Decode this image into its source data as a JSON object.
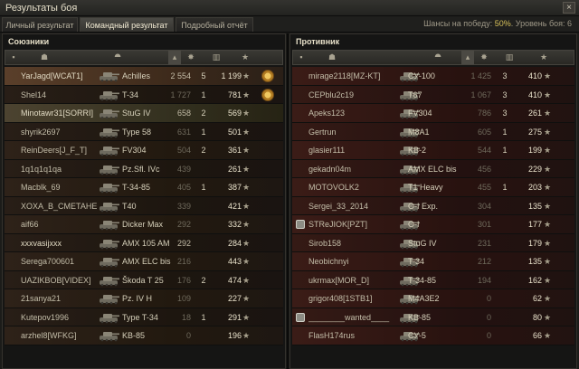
{
  "window": {
    "title": "Результаты боя",
    "close_glyph": "×"
  },
  "tabs": [
    {
      "label": "Личный результат",
      "active": false
    },
    {
      "label": "Командный результат",
      "active": true
    },
    {
      "label": "Подробный отчёт",
      "active": false
    }
  ],
  "chances": {
    "prefix": "Шансы на победу:",
    "value": "50%",
    "level": "Уровень боя: 6"
  },
  "allies": {
    "title": "Союзники",
    "header": {
      "squad": "▪",
      "player": "☗",
      "tank": "⯊",
      "sort": "▴",
      "damage": "✸",
      "kills": "▥",
      "xp": "★"
    },
    "players": [
      {
        "name": "YarJagd[WCAT1]",
        "tank": "Achilles",
        "damage": "2 554",
        "kills": "5",
        "xp": "1 199",
        "medal": true,
        "highlight": true,
        "dim": false
      },
      {
        "name": "Shel14",
        "tank": "T-34",
        "damage": "1 727",
        "kills": "1",
        "xp": "781",
        "medal": true,
        "dim": true
      },
      {
        "name": "Minotawr31[SORRI]",
        "tank": "StuG IV",
        "damage": "658",
        "kills": "2",
        "xp": "569",
        "medal": false,
        "dim": false,
        "self": true
      },
      {
        "name": "shyrik2697",
        "tank": "Type 58",
        "damage": "631",
        "kills": "1",
        "xp": "501",
        "dim": true
      },
      {
        "name": "ReinDeers[J_F_T]",
        "tank": "FV304",
        "damage": "504",
        "kills": "2",
        "xp": "361",
        "dim": true
      },
      {
        "name": "1q1q1q1qa",
        "tank": "Pz.Sfl. IVc",
        "damage": "439",
        "kills": "",
        "xp": "261",
        "dim": true
      },
      {
        "name": "Macblk_69",
        "tank": "T-34-85",
        "damage": "405",
        "kills": "1",
        "xp": "387",
        "dim": true
      },
      {
        "name": "XOXA_B_CMETAHE",
        "tank": "T40",
        "damage": "339",
        "kills": "",
        "xp": "421",
        "dim": true
      },
      {
        "name": "aif66",
        "tank": "Dicker Max",
        "damage": "292",
        "kills": "",
        "xp": "332",
        "dim": true
      },
      {
        "name": "xxxvasijxxx",
        "tank": "AMX 105 AM",
        "damage": "292",
        "kills": "",
        "xp": "284",
        "dim": false
      },
      {
        "name": "Serega700601",
        "tank": "AMX ELC bis",
        "damage": "216",
        "kills": "",
        "xp": "443",
        "dim": true
      },
      {
        "name": "UAZIKBOB[VIDEX]",
        "tank": "Škoda T 25",
        "damage": "176",
        "kills": "2",
        "xp": "474",
        "dim": true
      },
      {
        "name": "21sanya21",
        "tank": "Pz. IV H",
        "damage": "109",
        "kills": "",
        "xp": "227",
        "dim": true
      },
      {
        "name": "Kutepov1996",
        "tank": "Type T-34",
        "damage": "18",
        "kills": "1",
        "xp": "291",
        "dim": true
      },
      {
        "name": "arzhel8[WFKG]",
        "tank": "KB-85",
        "damage": "0",
        "kills": "",
        "xp": "196",
        "dim": true
      }
    ]
  },
  "enemies": {
    "title": "Противник",
    "header": {
      "squad": "▪",
      "player": "☗",
      "tank": "⯊",
      "sort": "▴",
      "damage": "✸",
      "kills": "▥",
      "xp": "★"
    },
    "players": [
      {
        "name": "mirage2118[MZ-KT]",
        "tank": "СУ-100",
        "damage": "1 425",
        "kills": "3",
        "xp": "410",
        "dim": true
      },
      {
        "name": "CEPblu2c19",
        "tank": "T67",
        "damage": "1 067",
        "kills": "3",
        "xp": "410",
        "dim": true
      },
      {
        "name": "Apeks123",
        "tank": "FV304",
        "damage": "786",
        "kills": "3",
        "xp": "261",
        "dim": true
      },
      {
        "name": "Gertrun",
        "tank": "M8A1",
        "damage": "605",
        "kills": "1",
        "xp": "275",
        "dim": true
      },
      {
        "name": "glasier111",
        "tank": "KB-2",
        "damage": "544",
        "kills": "1",
        "xp": "199",
        "dim": true
      },
      {
        "name": "gekadn04m",
        "tank": "AMX ELC bis",
        "damage": "456",
        "kills": "",
        "xp": "229",
        "dim": true
      },
      {
        "name": "MOTOVOLK2",
        "tank": "T1 Heavy",
        "damage": "455",
        "kills": "1",
        "xp": "203",
        "dim": true
      },
      {
        "name": "Sergei_33_2014",
        "tank": "O-I Exp.",
        "damage": "304",
        "kills": "",
        "xp": "135",
        "dim": true
      },
      {
        "name": "STReJIOK[PZT]",
        "tank": "O-I",
        "damage": "301",
        "kills": "",
        "xp": "177",
        "platoon": true,
        "dim": true
      },
      {
        "name": "Sirob158",
        "tank": "StuG IV",
        "damage": "231",
        "kills": "",
        "xp": "179",
        "dim": true
      },
      {
        "name": "Neobichnyi",
        "tank": "T-34",
        "damage": "212",
        "kills": "",
        "xp": "135",
        "dim": true
      },
      {
        "name": "ukrmax[MOR_D]",
        "tank": "T-34-85",
        "damage": "194",
        "kills": "",
        "xp": "162",
        "dim": true
      },
      {
        "name": "grigor408[1STB1]",
        "tank": "M4A3E2",
        "damage": "0",
        "kills": "",
        "xp": "62",
        "dim": true
      },
      {
        "name": "________wanted____",
        "tank": "KB-85",
        "damage": "0",
        "kills": "",
        "xp": "80",
        "platoon": true,
        "dim": true
      },
      {
        "name": "FlasH174rus",
        "tank": "СУ-5",
        "damage": "0",
        "kills": "",
        "xp": "66",
        "dim": true
      }
    ]
  },
  "colors": {
    "accent": "#d7c15a",
    "enemy_row": "#3b1c17",
    "ally_row": "#2e2219"
  }
}
